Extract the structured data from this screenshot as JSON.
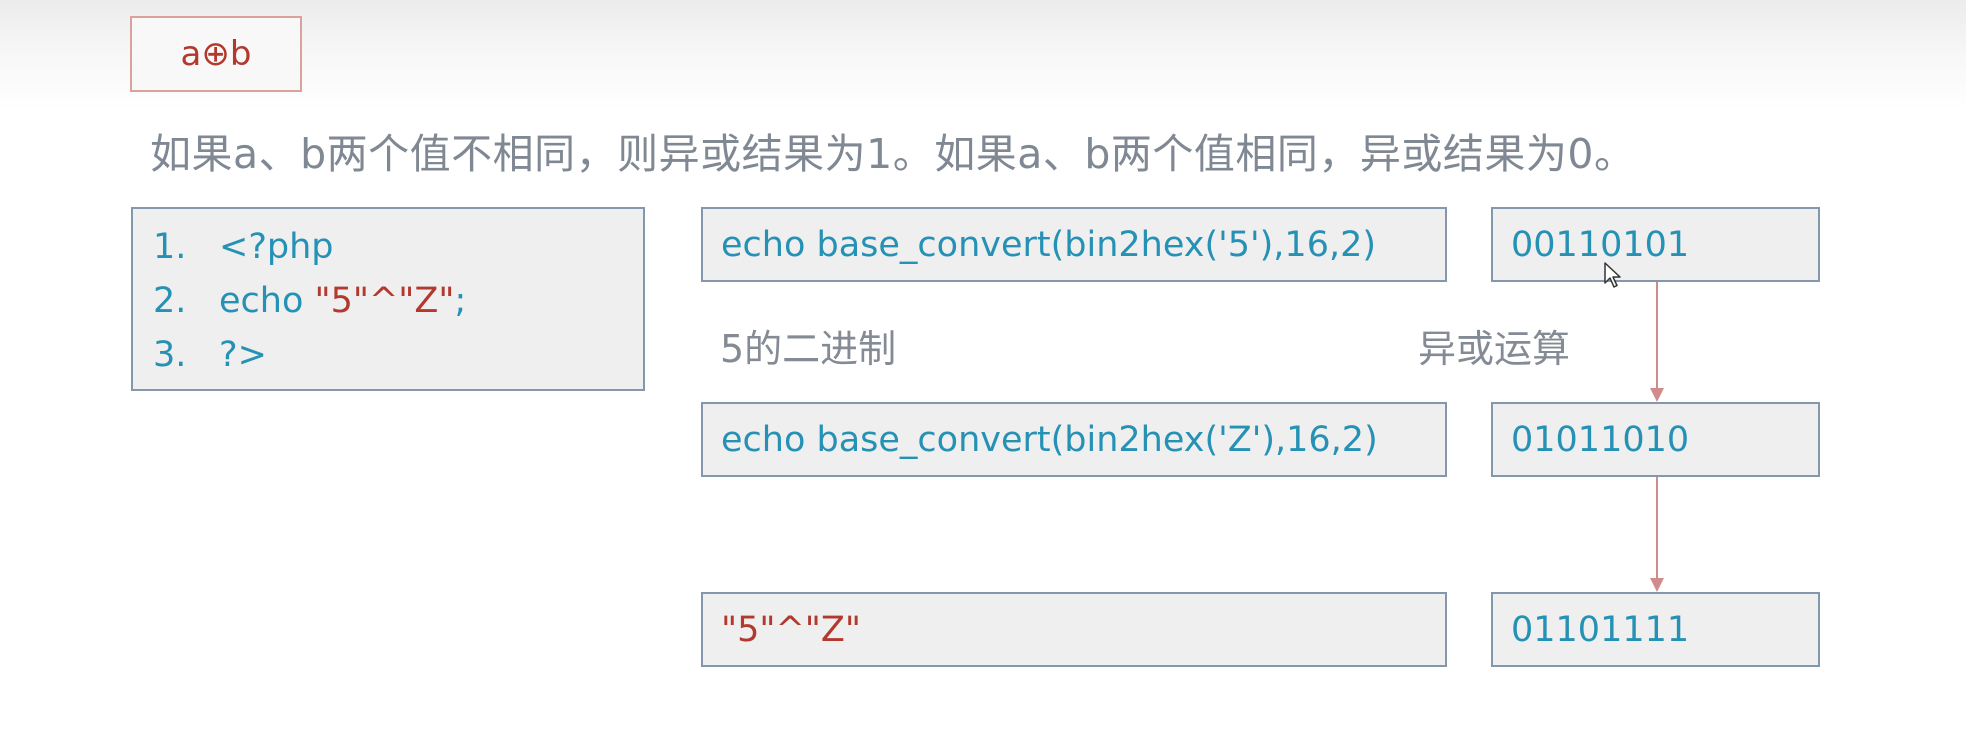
{
  "title": "a⊕b",
  "description": "如果a、b两个值不相同，则异或结果为1。如果a、b两个值相同，异或结果为0。",
  "code": [
    {
      "num": "1.",
      "text": "<?php"
    },
    {
      "num": "2.",
      "prefix": "echo ",
      "literal": "\"5\"^\"Z\"",
      "suffix": ";"
    },
    {
      "num": "3.",
      "text": "?>"
    }
  ],
  "rows": [
    {
      "expr": "echo base_convert(bin2hex('5'),16,2)",
      "binary": "00110101"
    },
    {
      "expr": "echo base_convert(bin2hex('Z'),16,2)",
      "binary": "01011010"
    },
    {
      "expr": "\"5\"^\"Z\"",
      "binary": "01101111"
    }
  ],
  "labels": {
    "binary_of_5": "5的二进制",
    "xor_operation": "异或运算"
  },
  "colors": {
    "code_blue": "#2591b5",
    "accent_red": "#b2392e",
    "box_border": "#8597ad",
    "box_fill": "#efefef",
    "arrow": "#d08b8b",
    "text_gray": "#7f8893"
  },
  "icons": [
    "cursor-pointer-icon",
    "arrow-down-icon"
  ]
}
